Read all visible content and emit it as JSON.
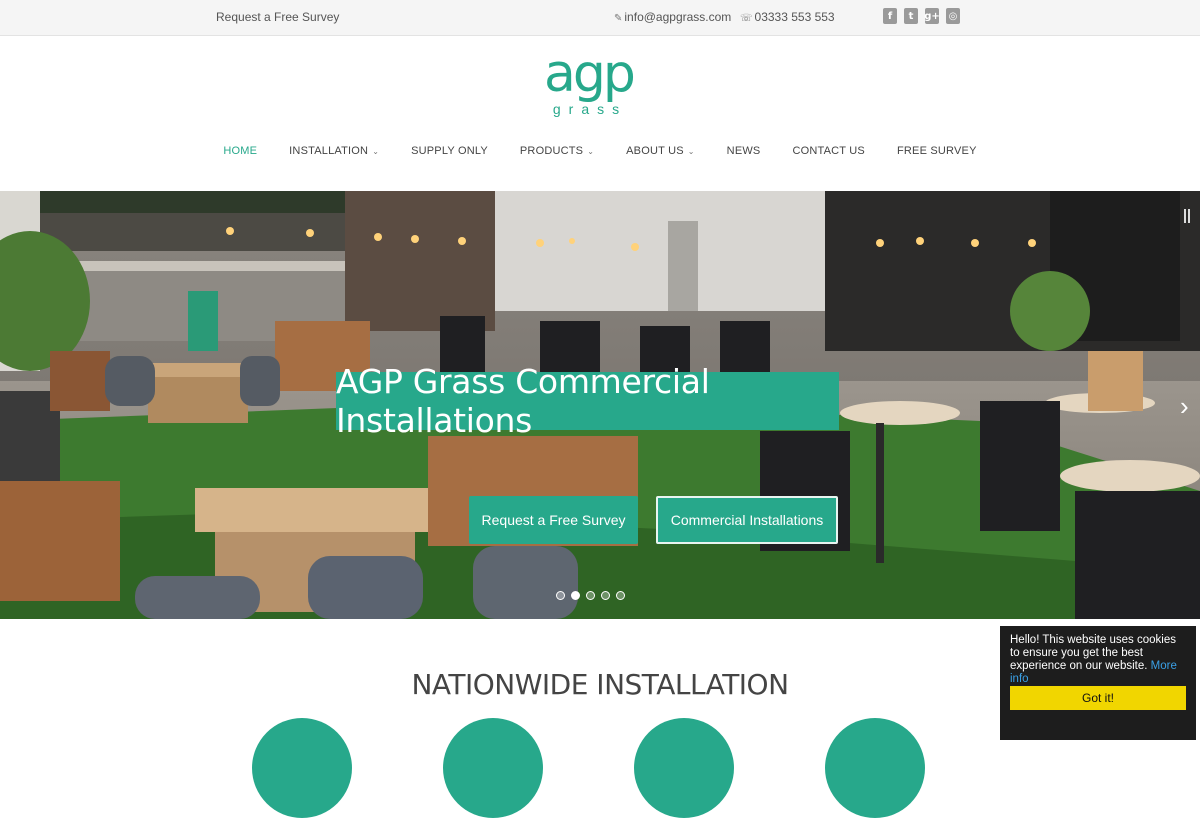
{
  "topbar": {
    "survey_link": "Request a Free Survey",
    "email": "info@agpgrass.com",
    "phone": "03333 553 553",
    "social": [
      {
        "icon": "facebook-icon",
        "glyph": "f"
      },
      {
        "icon": "twitter-icon",
        "glyph": "t"
      },
      {
        "icon": "google-plus-icon",
        "glyph": "g+"
      },
      {
        "icon": "instagram-icon",
        "glyph": "◎"
      }
    ]
  },
  "logo": {
    "main": "agp",
    "sub": "grass"
  },
  "nav": {
    "items": [
      {
        "label": "HOME",
        "active": true,
        "dropdown": false
      },
      {
        "label": "INSTALLATION",
        "active": false,
        "dropdown": true
      },
      {
        "label": "SUPPLY ONLY",
        "active": false,
        "dropdown": false
      },
      {
        "label": "PRODUCTS",
        "active": false,
        "dropdown": true
      },
      {
        "label": "ABOUT US",
        "active": false,
        "dropdown": true
      },
      {
        "label": "NEWS",
        "active": false,
        "dropdown": false
      },
      {
        "label": "CONTACT US",
        "active": false,
        "dropdown": false
      },
      {
        "label": "FREE SURVEY",
        "active": false,
        "dropdown": false
      }
    ]
  },
  "hero": {
    "title": "AGP Grass Commercial Installations",
    "buttons": {
      "survey": "Request a Free Survey",
      "commercial": "Commercial Installations"
    },
    "slides_total": 5,
    "active_slide": 2
  },
  "section": {
    "title": "NATIONWIDE INSTALLATION"
  },
  "cookie": {
    "message": "Hello! This website uses cookies to ensure you get the best experience on our website.",
    "more_info": "More info",
    "button": "Got it!"
  },
  "colors": {
    "accent": "#27a88b",
    "cookie_button": "#f1d600",
    "cookie_bg": "#1d1d1d"
  }
}
